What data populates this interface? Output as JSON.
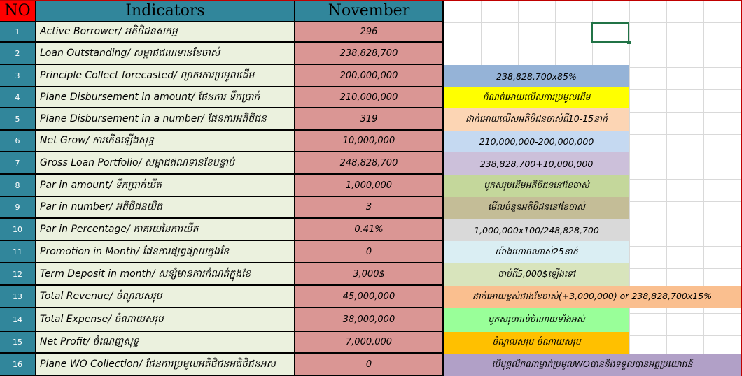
{
  "header": {
    "no": "NO",
    "indicators": "Indicators",
    "month": "November"
  },
  "rows": [
    {
      "no": "1",
      "indicator": "Active Borrower/ អតិថិជនសកម្ម",
      "value": "296",
      "note": "",
      "note_color": ""
    },
    {
      "no": "2",
      "indicator": "Loan Outstanding/ សម្ពាជឥណទានខែចាស់",
      "value": "238,828,700",
      "note": "",
      "note_color": ""
    },
    {
      "no": "3",
      "indicator": "Principle Collect forecasted/ ព្យាករការប្រមូលដើម",
      "value": "200,000,000",
      "note": "238,828,700x85%",
      "note_color": "#95b3d7"
    },
    {
      "no": "4",
      "indicator": "Plane Disbursement in amount/ ផែនការ ទឹកប្រាក់",
      "value": "210,000,000",
      "note": "កំណត់អោយលើសការប្រមូលដើម",
      "note_color": "#ffff00"
    },
    {
      "no": "5",
      "indicator": "Plane Disbursement in a number/ ផែនការអតិថិជន",
      "value": "319",
      "note": "ដាក់អោយលើសអតិថិជនចាស់ពី10-15នាក់",
      "note_color": "#fcd5b4"
    },
    {
      "no": "6",
      "indicator": "Net Grow/ ការកើនឡើងសុទ្ធ",
      "value": "10,000,000",
      "note": "210,000,000-200,000,000",
      "note_color": "#c5d9f1"
    },
    {
      "no": "7",
      "indicator": "Gross Loan Portfolio/ សម្ពាជឥណទានខែបន្ទាប់",
      "value": "248,828,700",
      "note": "238,828,700+10,000,000",
      "note_color": "#ccc0da"
    },
    {
      "no": "8",
      "indicator": "Par in amount/ ទឹកប្រាក់យឺត",
      "value": "1,000,000",
      "note": "បូកសរុបដើមអតិថិជននៅខែចាស់",
      "note_color": "#c4d79b"
    },
    {
      "no": "9",
      "indicator": "Par in number/ អតិថិជនយឺត",
      "value": "3",
      "note": "មើលចំនួនអតិថិជននៅខែចាស់",
      "note_color": "#c4bd97"
    },
    {
      "no": "10",
      "indicator": "Par in Percentage/ ភាគរយនៃការយឺត",
      "value": "0.41%",
      "note": "1,000,000x100/248,828,700",
      "note_color": "#d9d9d9"
    },
    {
      "no": "11",
      "indicator": "Promotion in Month/ ផែនការផ្សព្វផ្សាយក្នុងខែ",
      "value": "0",
      "note": "យ៉ាងហោចណាស់25នាក់",
      "note_color": "#daeef3"
    },
    {
      "no": "12",
      "indicator": "Term Deposit in month/ សន្សំមានការកំណត់ក្នុងខែ",
      "value": "3,000$",
      "note": "ចាប់ពី5,000$ឡើងទៅ",
      "note_color": "#d8e4bc"
    },
    {
      "no": "13",
      "indicator": "Total Revenue/ ចំណូលសរុប",
      "value": "45,000,000",
      "note": "ដាក់អោយខ្ពស់ជាងខែចាស់(+3,000,000) or 238,828,700x15%",
      "note_color": "#fabf8f"
    },
    {
      "no": "14",
      "indicator": "Total Expense/ ចំណាយសរុប",
      "value": "38,000,000",
      "note": "បូកសរុបរាល់ចំណាយទាំងអស់",
      "note_color": "#99ff99"
    },
    {
      "no": "15",
      "indicator": "Net Profit/ ចំណេញសុទ្ធ",
      "value": "7,000,000",
      "note": "ចំណូលសរុប-ចំណាយសរុប",
      "note_color": "#ffc000"
    },
    {
      "no": "16",
      "indicator": "Plane WO Collection/ ផែនការប្រមូលអតិថិជនអតិថិជនអស",
      "value": "0",
      "note": "បើបុគ្គលិកណាម្នាក់ប្រមូលWOបាននឹងទទួលបានអត្ថប្រយោជន៍",
      "note_color": "#b1a0c7"
    }
  ]
}
